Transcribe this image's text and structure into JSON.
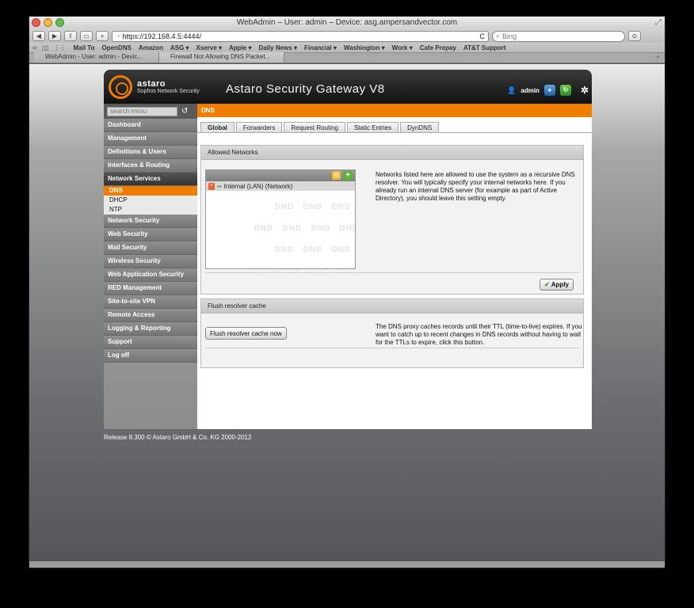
{
  "window": {
    "title": "WebAdmin – User: admin – Device: asg.ampersandvector.com"
  },
  "toolbar": {
    "back": "◀",
    "forward": "▶",
    "share": "⇪",
    "sidebar": "▭",
    "add": "+",
    "url": "https://192.168.4.5:4444/",
    "reload": "C",
    "search_placeholder": "Bing",
    "download": "⊙"
  },
  "bookmarks": [
    "Mail To",
    "OpenDNS",
    "Amazon",
    "ASG ▾",
    "Xserve ▾",
    "Apple ▾",
    "Daily News ▾",
    "Financial ▾",
    "Washington ▾",
    "Work ▾",
    "Cafe Prepay",
    "AT&T Support"
  ],
  "tabs": [
    {
      "label": "WebAdmin - User: admin - Devic..."
    },
    {
      "label": "Firewall Not Allowing DNS Packet..."
    }
  ],
  "header": {
    "brand": "astaro",
    "brand_sub": "Sophos Network Security",
    "product": "Astaro Security Gateway V8",
    "user": "admin"
  },
  "sidebar": {
    "search_placeholder": "search menu",
    "items_top": [
      "Dashboard",
      "Management",
      "Definitions & Users",
      "Interfaces & Routing"
    ],
    "section": "Network Services",
    "sub_items": [
      "DNS",
      "DHCP",
      "NTP"
    ],
    "items_bottom": [
      "Network Security",
      "Web Security",
      "Mail Security",
      "Wireless Security",
      "Web Application Security",
      "RED Management",
      "Site-to-site VPN",
      "Remote Access",
      "Logging & Reporting",
      "Support",
      "Log off"
    ]
  },
  "content": {
    "breadcrumb": "DNS",
    "tabs": [
      "Global",
      "Forwarders",
      "Request Routing",
      "Static Entries",
      "DynDNS"
    ],
    "allowed": {
      "title": "Allowed Networks",
      "network": "Internal (LAN) (Network)",
      "watermark": "DND",
      "help": "Networks listed here are allowed to use the system as a recursive DNS resolver. You will typically specify your internal networks here. If you already run an internal DNS server (for example as part of Active Directory), you should leave this setting empty.",
      "apply": "Apply"
    },
    "flush": {
      "title": "Flush resolver cache",
      "button": "Flush resolver cache now",
      "help": "The DNS proxy caches records until their TTL (time-to-live) expires. If you want to catch up to recent changes in DNS records without having to wait for the TTLs to expire, click this button."
    }
  },
  "footer": "Release 8.300 © Astaro GmbH & Co. KG 2000-2012"
}
